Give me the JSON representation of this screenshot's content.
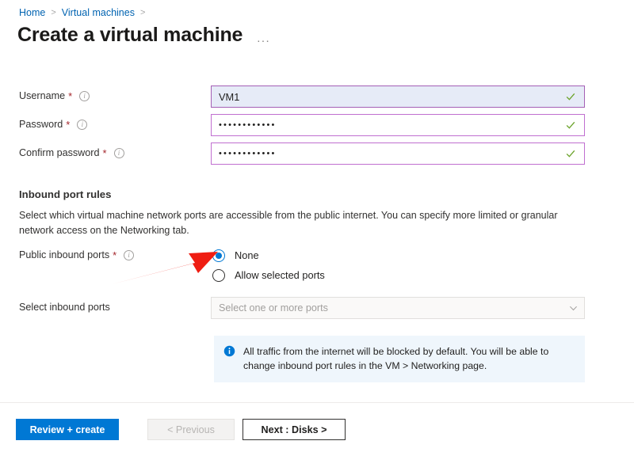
{
  "breadcrumb": {
    "items": [
      {
        "label": "Home"
      },
      {
        "label": "Virtual machines"
      }
    ],
    "separator": ">"
  },
  "header": {
    "title": "Create a virtual machine",
    "more_label": "..."
  },
  "form": {
    "username": {
      "label": "Username",
      "required_mark": "*",
      "value": "VM1",
      "valid_icon": "checkmark-icon"
    },
    "password": {
      "label": "Password",
      "required_mark": "*",
      "value": "••••••••••••",
      "valid_icon": "checkmark-icon"
    },
    "confirm_password": {
      "label": "Confirm password",
      "required_mark": "*",
      "value": "••••••••••••",
      "valid_icon": "checkmark-icon"
    }
  },
  "inbound": {
    "heading": "Inbound port rules",
    "description": "Select which virtual machine network ports are accessible from the public internet. You can specify more limited or granular network access on the Networking tab.",
    "public_ports_label": "Public inbound ports",
    "public_ports_required": "*",
    "options": [
      {
        "label": "None",
        "selected": true
      },
      {
        "label": "Allow selected ports",
        "selected": false
      }
    ],
    "select_ports_label": "Select inbound ports",
    "select_ports_placeholder": "Select one or more ports",
    "banner_text": "All traffic from the internet will be blocked by default. You will be able to change inbound port rules in the VM > Networking page."
  },
  "footer": {
    "review_create": "Review + create",
    "previous": "< Previous",
    "next": "Next : Disks >"
  },
  "colors": {
    "accent": "#0078d4",
    "field_border": "#c06fd0",
    "valid": "#498205",
    "required": "#a4262c",
    "banner_bg": "#eff6fc",
    "annotation_arrow": "#ef1d12"
  }
}
